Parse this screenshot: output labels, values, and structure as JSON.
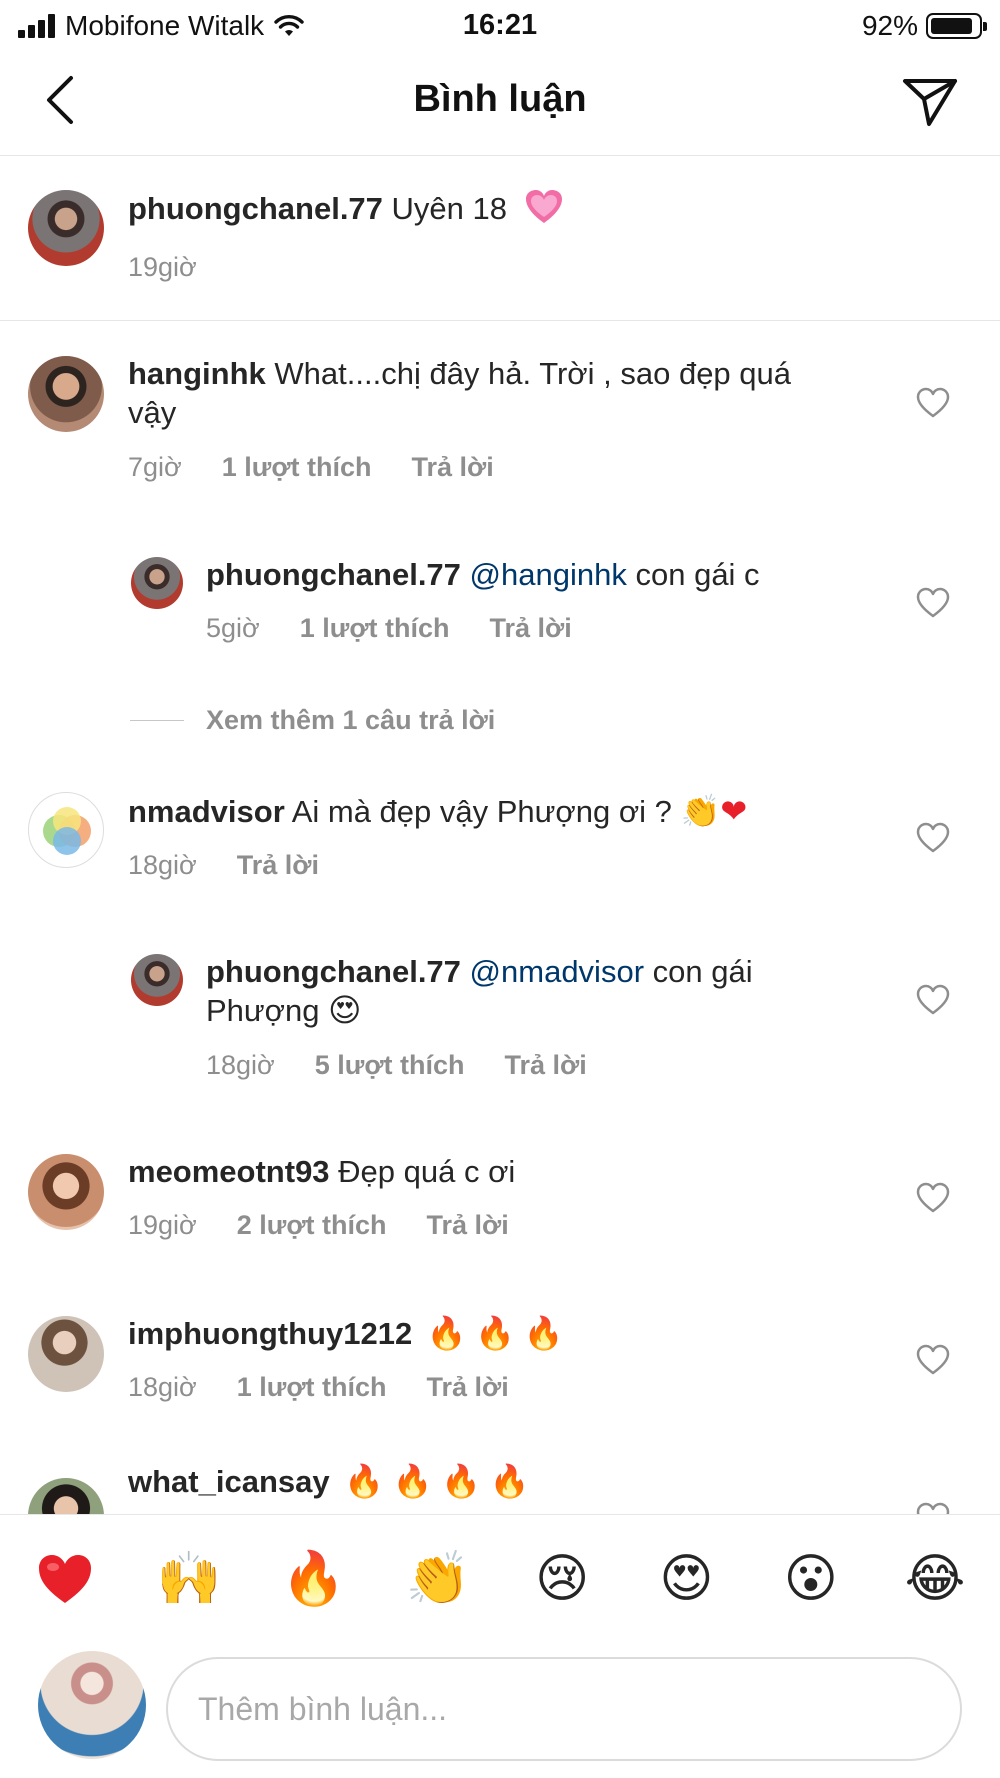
{
  "status": {
    "carrier": "Mobifone Witalk",
    "time": "16:21",
    "battery": "92%",
    "battery_level": 0.92
  },
  "header": {
    "title": "Bình luận"
  },
  "caption": {
    "user": "phuongchanel.77",
    "text": "Uyên 18",
    "time": "19giờ"
  },
  "comments": [
    {
      "user": "hanginhk",
      "text_line1": "What....chị đây hả. Trời , sao đẹp quá",
      "text_line2": "vậy",
      "time": "7giờ",
      "likes": "1 lượt thích",
      "reply": "Trả lời"
    },
    {
      "user": "phuongchanel.77",
      "mention": "@hanginhk",
      "text": "con gái c",
      "time": "5giờ",
      "likes": "1 lượt thích",
      "reply": "Trả lời"
    },
    {
      "view_more": "Xem thêm 1 câu trả lời"
    },
    {
      "user": "nmadvisor",
      "text": "Ai mà đẹp vậy Phượng ơi ?",
      "time": "18giờ",
      "reply": "Trả lời"
    },
    {
      "user": "phuongchanel.77",
      "mention": "@nmadvisor",
      "text_line1": "con gái",
      "text_line2": "Phượng",
      "time": "18giờ",
      "likes": "5 lượt thích",
      "reply": "Trả lời"
    },
    {
      "user": "meomeotnt93",
      "text": "Đẹp quá c ơi",
      "time": "19giờ",
      "likes": "2 lượt thích",
      "reply": "Trả lời"
    },
    {
      "user": "imphuongthuy1212",
      "time": "18giờ",
      "likes": "1 lượt thích",
      "reply": "Trả lời"
    },
    {
      "user": "what_icansay"
    }
  ],
  "icons": {
    "back": "chevron-left-icon",
    "send": "paper-plane-icon",
    "like": "heart-outline-icon"
  },
  "emoji_bar": [
    "heart",
    "raised-hands",
    "fire",
    "clapping-hands",
    "crying-face",
    "heart-eyes",
    "surprised-face",
    "tears-of-joy"
  ],
  "input": {
    "placeholder": "Thêm bình luận..."
  },
  "colors": {
    "mention": "#00376b",
    "meta": "#8e8e8e",
    "text": "#262626",
    "divider": "#e6e6e6"
  }
}
